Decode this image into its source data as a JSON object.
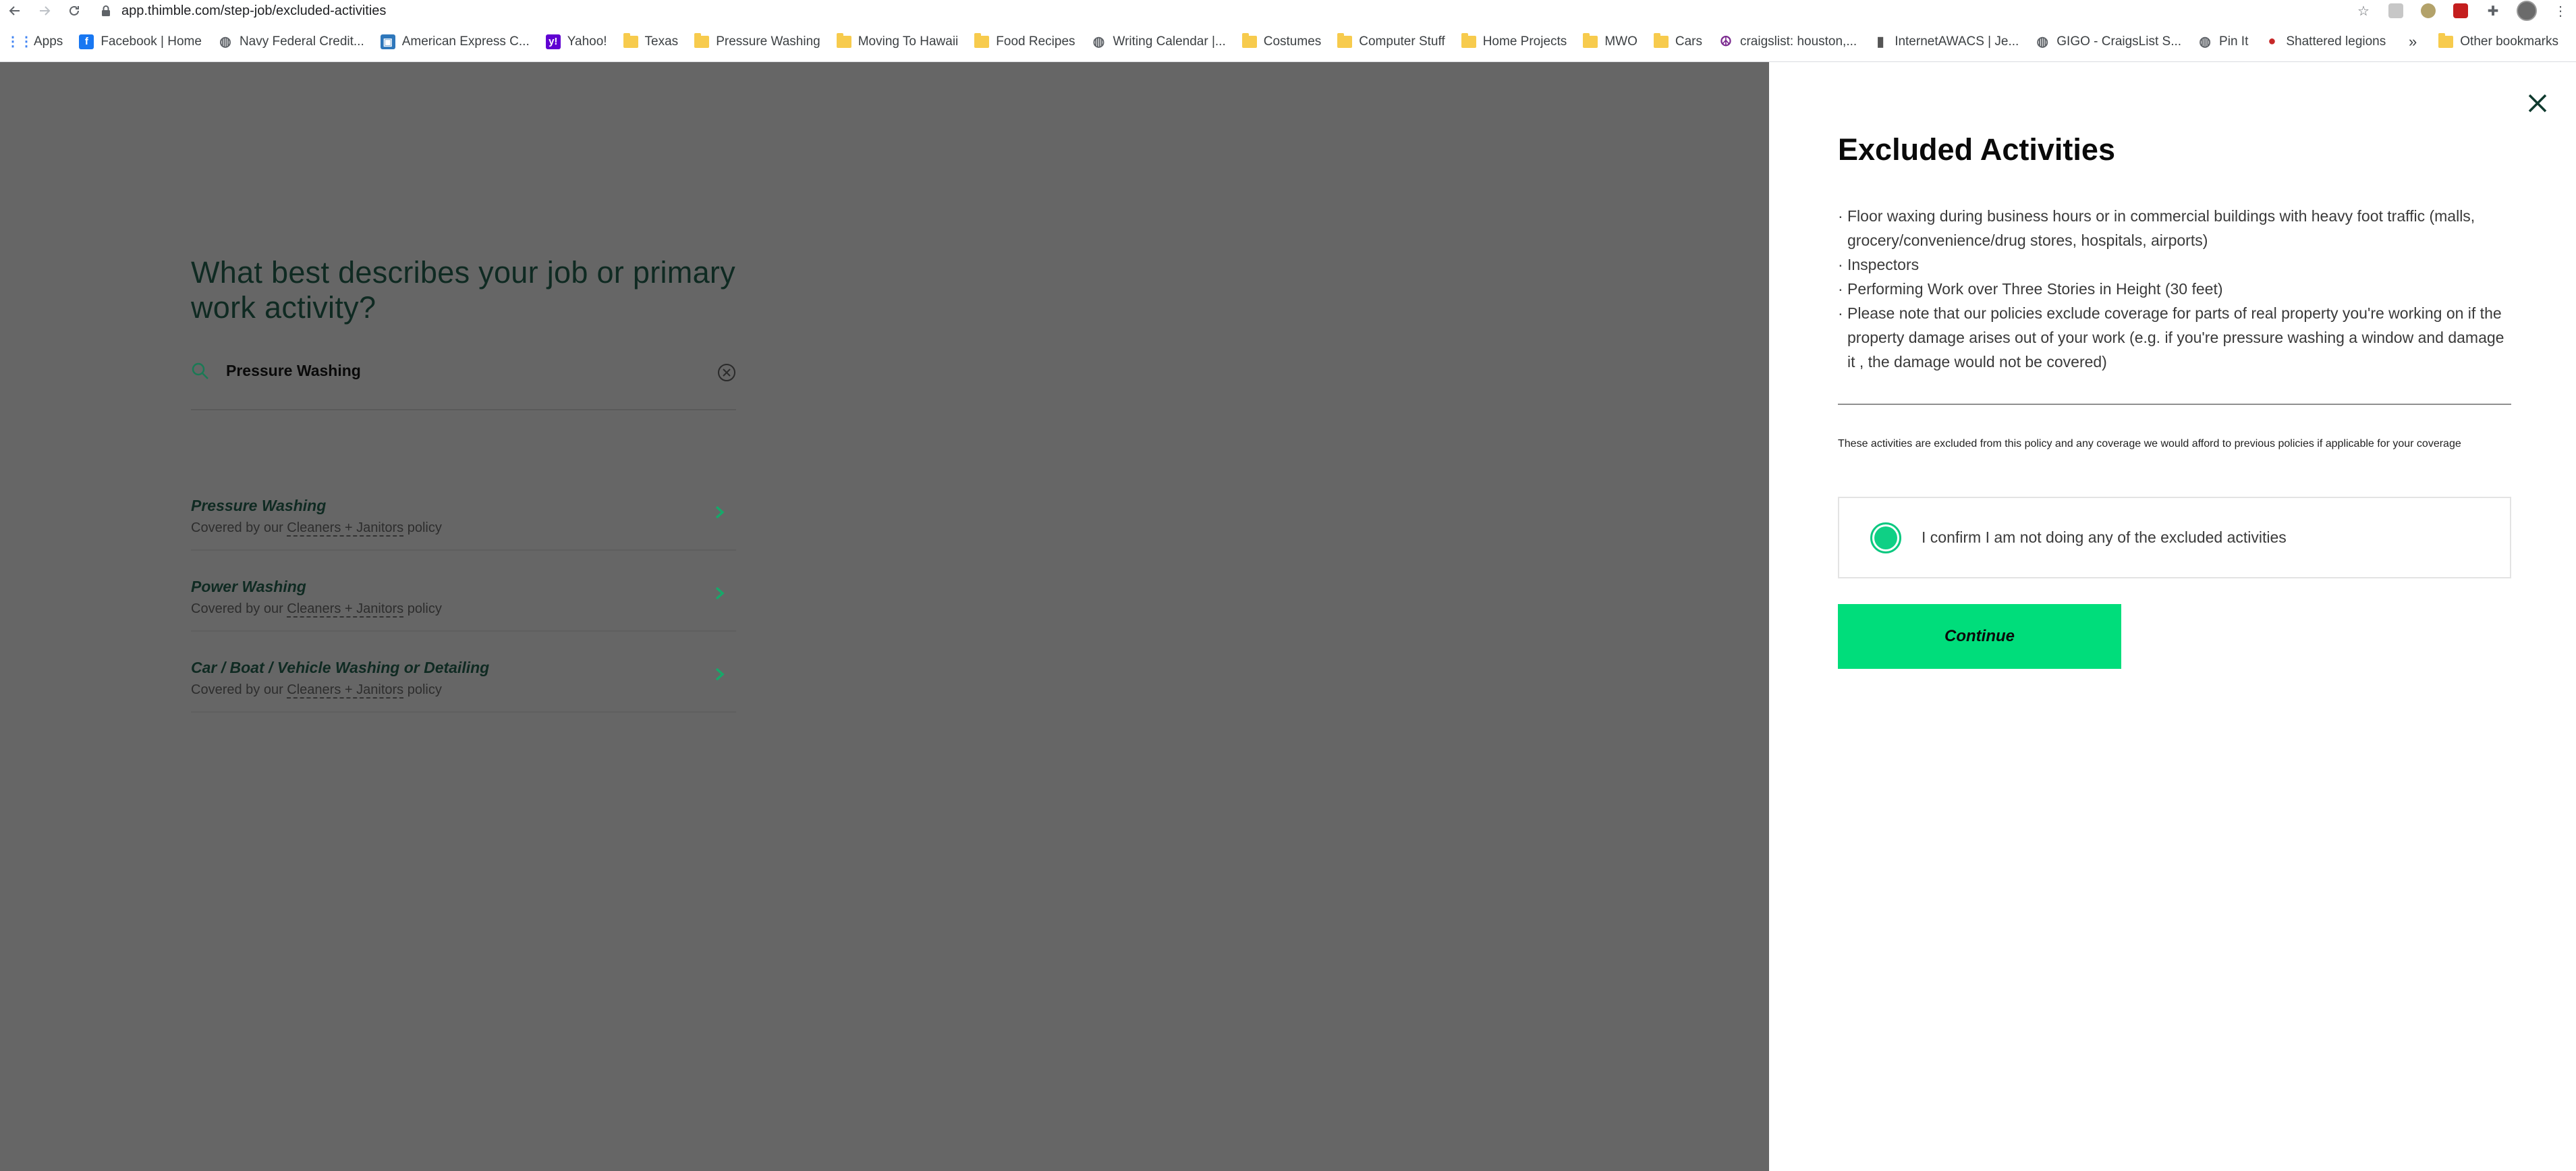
{
  "browser": {
    "url": "app.thimble.com/step-job/excluded-activities",
    "bookmarks": [
      {
        "label": "Apps",
        "icon": "apps-grid-icon",
        "color": "#4285f4"
      },
      {
        "label": "Facebook | Home",
        "icon": "facebook-icon",
        "color": "#1877f2"
      },
      {
        "label": "Navy Federal Credit...",
        "icon": "globe-icon",
        "color": "#5f6368"
      },
      {
        "label": "American Express C...",
        "icon": "amex-icon",
        "color": "#2e77bb"
      },
      {
        "label": "Yahoo!",
        "icon": "yahoo-icon",
        "color": "#6001d2"
      },
      {
        "label": "Texas",
        "icon": "folder-icon",
        "color": "#f7cb4d"
      },
      {
        "label": "Pressure Washing",
        "icon": "folder-icon",
        "color": "#f7cb4d"
      },
      {
        "label": "Moving To Hawaii",
        "icon": "folder-icon",
        "color": "#f7cb4d"
      },
      {
        "label": "Food Recipes",
        "icon": "folder-icon",
        "color": "#f7cb4d"
      },
      {
        "label": "Writing Calendar |...",
        "icon": "globe-icon",
        "color": "#5f6368"
      },
      {
        "label": "Costumes",
        "icon": "folder-icon",
        "color": "#f7cb4d"
      },
      {
        "label": "Computer Stuff",
        "icon": "folder-icon",
        "color": "#f7cb4d"
      },
      {
        "label": "Home Projects",
        "icon": "folder-icon",
        "color": "#f7cb4d"
      },
      {
        "label": "MWO",
        "icon": "folder-icon",
        "color": "#f7cb4d"
      },
      {
        "label": "Cars",
        "icon": "folder-icon",
        "color": "#f7cb4d"
      },
      {
        "label": "craigslist: houston,...",
        "icon": "peace-icon",
        "color": "#7b2a8f"
      },
      {
        "label": "InternetAWACS | Je...",
        "icon": "bars-icon",
        "color": "#555555"
      },
      {
        "label": "GIGO - CraigsList S...",
        "icon": "globe-icon",
        "color": "#5f6368"
      },
      {
        "label": "Pin It",
        "icon": "globe-icon",
        "color": "#5f6368"
      },
      {
        "label": "Shattered legions",
        "icon": "skull-icon",
        "color": "#c62828"
      }
    ],
    "more_bookmarks_label": "»",
    "other_bookmarks_label": "Other bookmarks"
  },
  "job_step": {
    "question": "What best describes your job or primary work activity?",
    "search_value": "Pressure Washing",
    "results": [
      {
        "title": "Pressure Washing",
        "sub_prefix": "Covered by our ",
        "sub_link": "Cleaners + Janitors",
        "sub_suffix": " policy"
      },
      {
        "title": "Power Washing",
        "sub_prefix": "Covered by our ",
        "sub_link": "Cleaners + Janitors",
        "sub_suffix": " policy"
      },
      {
        "title": "Car / Boat / Vehicle Washing or Detailing",
        "sub_prefix": "Covered by our ",
        "sub_link": "Cleaners + Janitors",
        "sub_suffix": " policy"
      }
    ]
  },
  "drawer": {
    "title": "Excluded Activities",
    "exclusions": [
      "Floor waxing during business hours or in commercial buildings with heavy foot traffic (malls, grocery/convenience/drug stores, hospitals, airports)",
      "Inspectors",
      "Performing Work over Three Stories in Height (30 feet)",
      "Please note that our policies exclude coverage for parts of real property you're working on if the property damage arises out of your work (e.g. if you're pressure washing a window and damage it , the damage would not be covered)"
    ],
    "notice": "These activities are excluded from this policy and any coverage we would afford to previous policies if applicable for your coverage",
    "confirm_label": "I confirm I am not doing any of the excluded activities",
    "confirm_checked": true,
    "continue_label": "Continue"
  },
  "colors": {
    "accent_green": "#00dd7b",
    "overlay_gray": "#666666",
    "title_dark_green": "#0f2a22"
  }
}
